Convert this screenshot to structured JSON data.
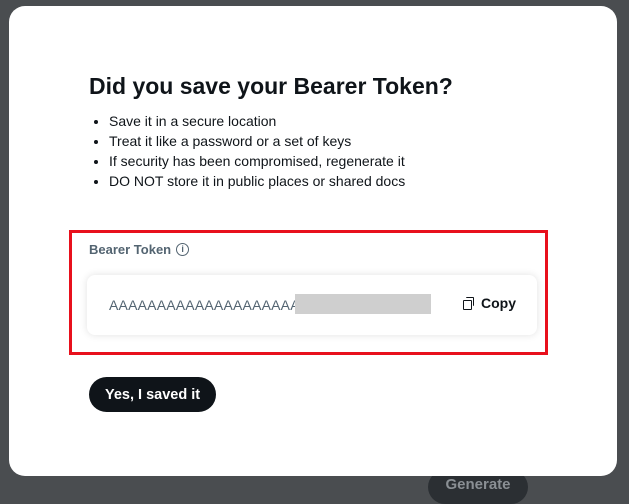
{
  "background": {
    "generate_button_label": "Generate"
  },
  "modal": {
    "title": "Did you save your Bearer Token?",
    "tips": [
      "Save it in a secure location",
      "Treat it like a password or a set of keys",
      "If security has been compromised, regenerate it",
      "DO NOT store it in public places or shared docs"
    ],
    "token_label": "Bearer Token",
    "info_icon": "info-icon",
    "token_value": "AAAAAAAAAAAAAAAAAAAAA",
    "copy_label": "Copy",
    "copy_icon": "copy-icon",
    "confirm_label": "Yes, I saved it"
  },
  "colors": {
    "primary_button": "#0f1419",
    "highlight_border": "#e8101c",
    "muted_text": "#536471"
  }
}
